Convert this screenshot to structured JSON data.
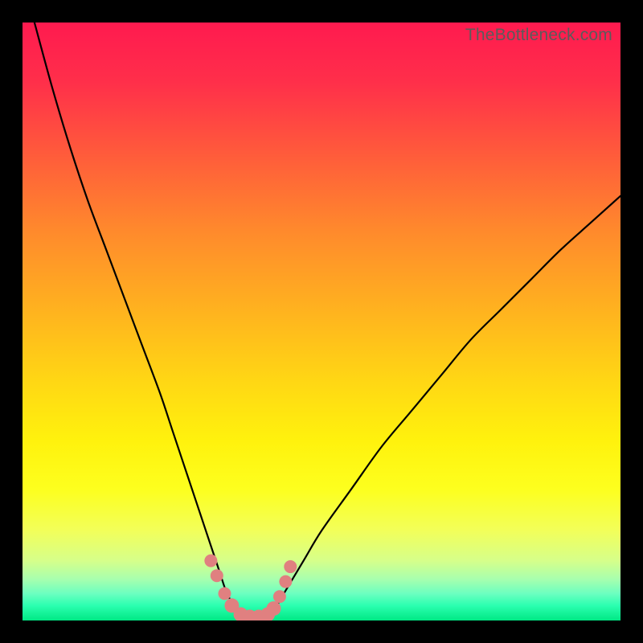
{
  "watermark": "TheBottleneck.com",
  "chart_data": {
    "type": "line",
    "title": "",
    "xlabel": "",
    "ylabel": "",
    "xlim": [
      0,
      100
    ],
    "ylim": [
      0,
      100
    ],
    "series": [
      {
        "name": "bottleneck-curve",
        "color": "#000000",
        "x": [
          2,
          5,
          8,
          11,
          14,
          17,
          20,
          23,
          25,
          27,
          29,
          30,
          31,
          32,
          33,
          34,
          35,
          36,
          38,
          40,
          41,
          42.5,
          44,
          47,
          50,
          55,
          60,
          65,
          70,
          75,
          80,
          85,
          90,
          95,
          100
        ],
        "values": [
          100,
          89,
          79,
          70,
          62,
          54,
          46,
          38,
          32,
          26,
          20,
          17,
          14,
          11,
          8,
          5,
          3,
          1.5,
          0.5,
          0.5,
          1,
          2.5,
          5,
          10,
          15,
          22,
          29,
          35,
          41,
          47,
          52,
          57,
          62,
          66.5,
          71
        ]
      },
      {
        "name": "marker-strip",
        "type": "scatter",
        "color": "#e08080",
        "x": [
          31.5,
          32.5,
          33.8,
          35,
          36.5,
          38,
          39.5,
          41,
          42,
          43,
          44,
          44.8
        ],
        "values": [
          10,
          7.5,
          4.5,
          2.5,
          1,
          0.6,
          0.6,
          1,
          2,
          4,
          6.5,
          9
        ]
      }
    ],
    "gradient_stops": [
      {
        "pos": 0.0,
        "color": "#ff1a4f"
      },
      {
        "pos": 0.1,
        "color": "#ff2f4a"
      },
      {
        "pos": 0.22,
        "color": "#ff5b3b"
      },
      {
        "pos": 0.35,
        "color": "#ff8a2c"
      },
      {
        "pos": 0.48,
        "color": "#ffb21f"
      },
      {
        "pos": 0.6,
        "color": "#ffd714"
      },
      {
        "pos": 0.7,
        "color": "#fff20d"
      },
      {
        "pos": 0.78,
        "color": "#fdff1e"
      },
      {
        "pos": 0.85,
        "color": "#f2ff5a"
      },
      {
        "pos": 0.9,
        "color": "#d6ff8a"
      },
      {
        "pos": 0.93,
        "color": "#a9ffad"
      },
      {
        "pos": 0.955,
        "color": "#6cffc0"
      },
      {
        "pos": 0.975,
        "color": "#2bffb0"
      },
      {
        "pos": 1.0,
        "color": "#00e884"
      }
    ]
  }
}
